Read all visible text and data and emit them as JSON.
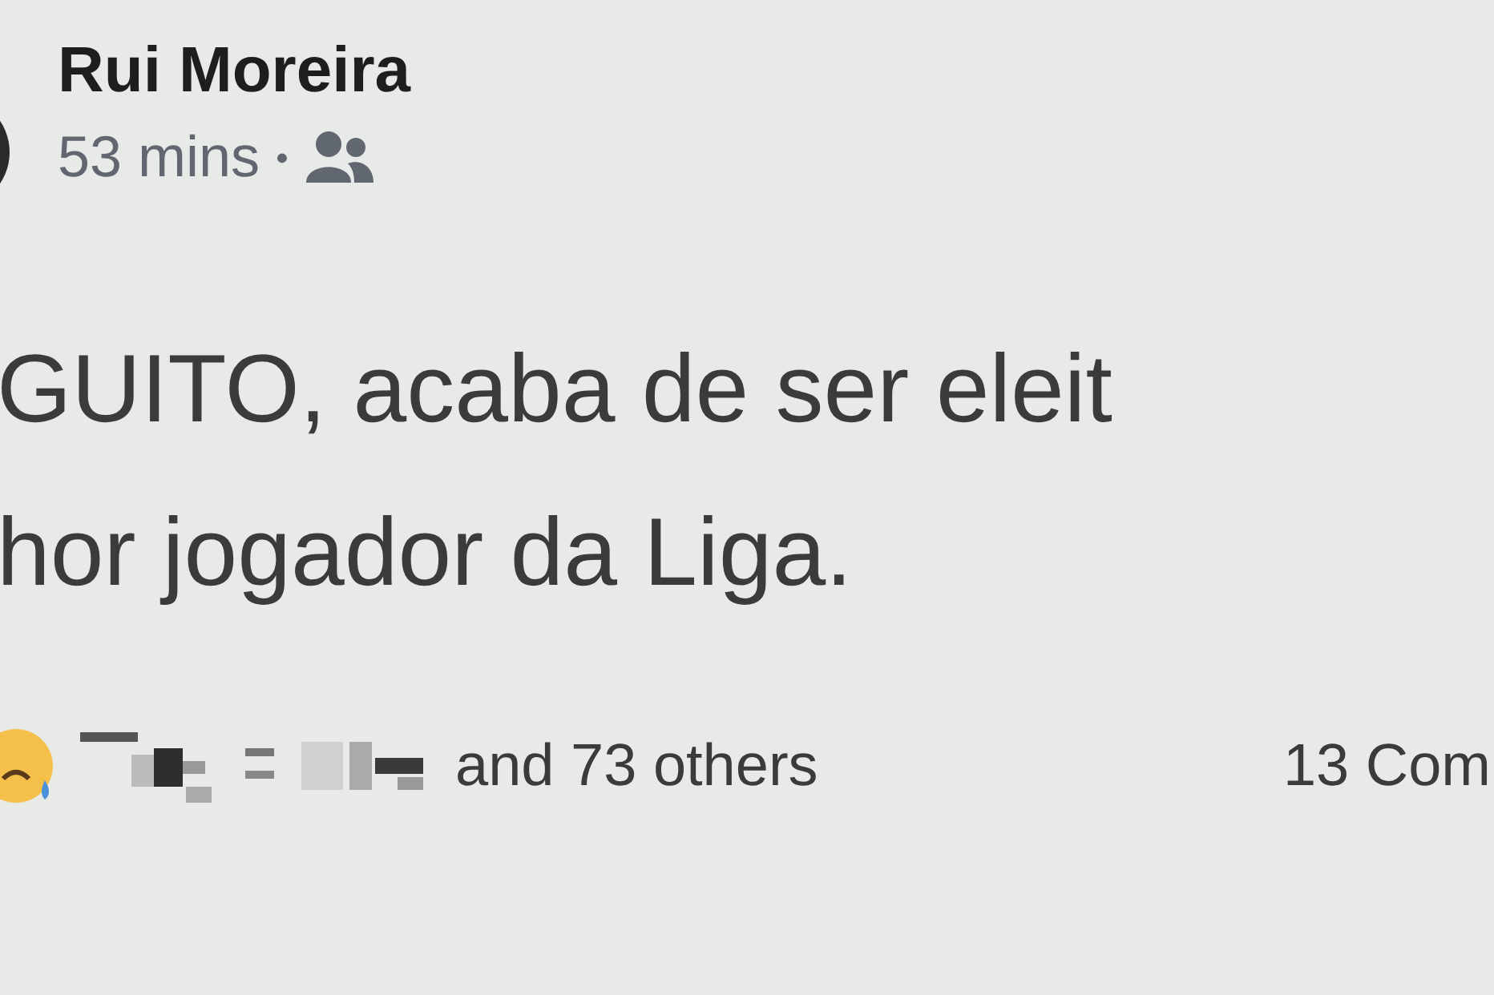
{
  "post": {
    "author": "Rui Moreira",
    "time": "53 mins",
    "separator": "•",
    "body_lines": [
      "GUITO, acaba de ser eleit",
      "hor jogador da Liga."
    ],
    "reactions_text": "and 73 others",
    "comments": "13 Com"
  }
}
